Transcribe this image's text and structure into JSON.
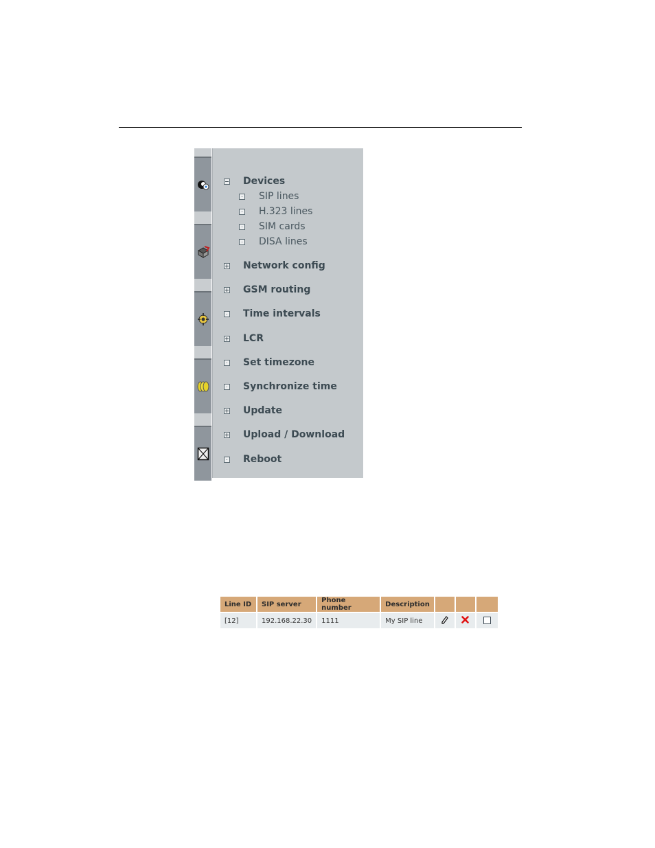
{
  "menu": {
    "items": [
      {
        "label": "Devices",
        "state": "expanded"
      },
      {
        "label": "SIP lines",
        "state": "leaf"
      },
      {
        "label": "H.323 lines",
        "state": "leaf"
      },
      {
        "label": "SIM cards",
        "state": "leaf"
      },
      {
        "label": "DISA lines",
        "state": "leaf"
      },
      {
        "label": "Network config",
        "state": "collapsed"
      },
      {
        "label": "GSM routing",
        "state": "collapsed"
      },
      {
        "label": "Time intervals",
        "state": "leaf"
      },
      {
        "label": "LCR",
        "state": "collapsed"
      },
      {
        "label": "Set timezone",
        "state": "leaf"
      },
      {
        "label": "Synchronize time",
        "state": "leaf"
      },
      {
        "label": "Update",
        "state": "collapsed"
      },
      {
        "label": "Upload / Download",
        "state": "collapsed"
      },
      {
        "label": "Reboot",
        "state": "leaf"
      }
    ]
  },
  "strip_icons": [
    "user-icon",
    "network-icon",
    "gear-icon",
    "coins-icon",
    "mail-icon"
  ],
  "sip_table": {
    "headers": [
      "Line ID",
      "SIP server",
      "Phone number",
      "Description",
      "",
      "",
      ""
    ],
    "rows": [
      {
        "line_id": "[12]",
        "sip_server": "192.168.22.30",
        "phone_number": "1111",
        "description": "My SIP line"
      }
    ]
  },
  "colors": {
    "panel": "#c4c9cc",
    "strip_tab": "#8f969d",
    "table_header": "#d6a878",
    "table_row": "#e8ecee",
    "delete": "#e01010"
  }
}
